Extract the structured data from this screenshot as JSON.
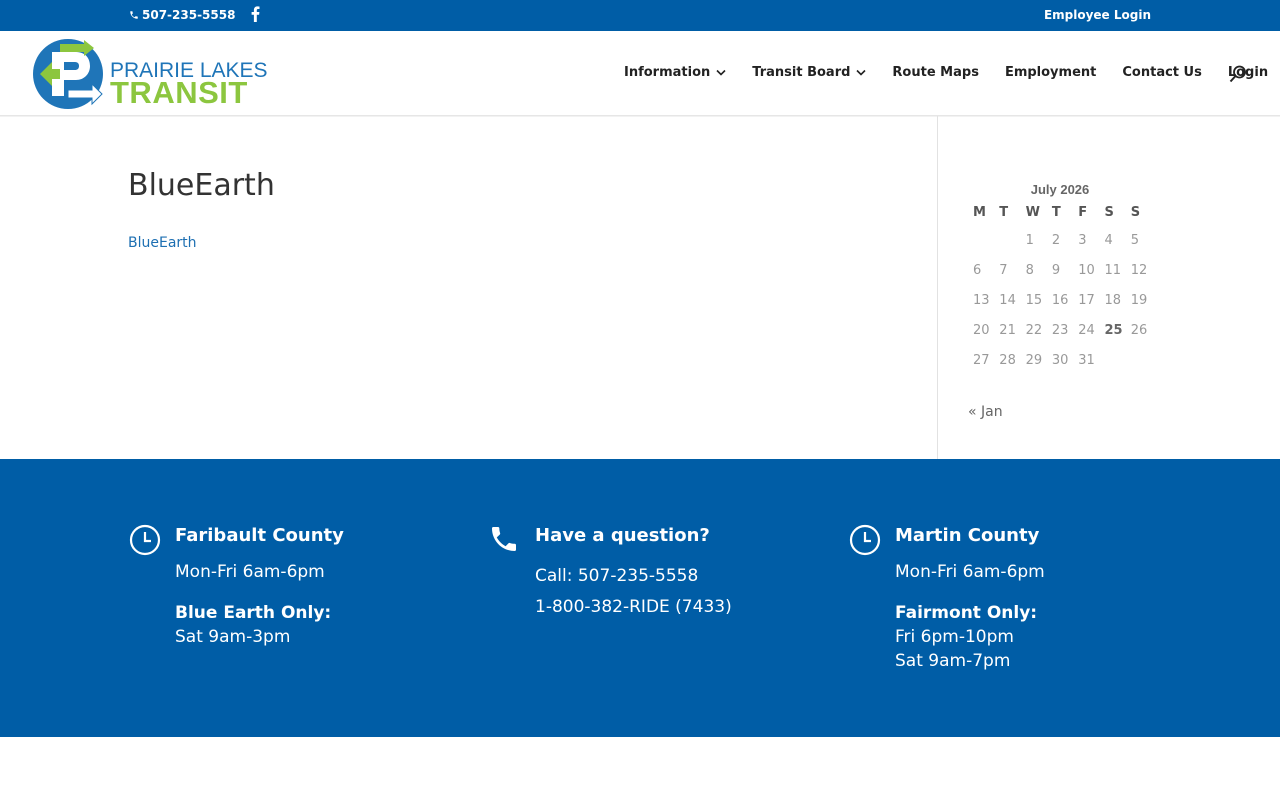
{
  "topbar": {
    "phone": "507-235-5558",
    "facebook_icon": "facebook-icon",
    "employee_login": "Employee Login"
  },
  "logo": {
    "line1": "PRAIRIE LAKES",
    "line2": "TRANSIT"
  },
  "nav": {
    "items": [
      {
        "label": "Information",
        "has_dropdown": true
      },
      {
        "label": "Transit Board",
        "has_dropdown": true
      },
      {
        "label": "Route Maps",
        "has_dropdown": false
      },
      {
        "label": "Employment",
        "has_dropdown": false
      },
      {
        "label": "Contact Us",
        "has_dropdown": false
      },
      {
        "label": "Login",
        "has_dropdown": false
      }
    ],
    "search_icon": "search-icon"
  },
  "main": {
    "title": "BlueEarth",
    "link": "BlueEarth"
  },
  "calendar": {
    "caption": "July 2026",
    "weekdays": [
      "M",
      "T",
      "W",
      "T",
      "F",
      "S",
      "S"
    ],
    "weeks": [
      [
        "",
        "",
        "1",
        "2",
        "3",
        "4",
        "5"
      ],
      [
        "6",
        "7",
        "8",
        "9",
        "10",
        "11",
        "12"
      ],
      [
        "13",
        "14",
        "15",
        "16",
        "17",
        "18",
        "19"
      ],
      [
        "20",
        "21",
        "22",
        "23",
        "24",
        "25",
        "26"
      ],
      [
        "27",
        "28",
        "29",
        "30",
        "31",
        "",
        ""
      ]
    ],
    "today": "25",
    "prev_link": "« Jan"
  },
  "footer": {
    "col1": {
      "icon": "clock-icon",
      "heading": "Faribault County",
      "hours": "Mon-Fri 6am-6pm",
      "sub_heading": "Blue Earth Only:",
      "sub_lines": [
        "Sat 9am-3pm"
      ]
    },
    "col2": {
      "icon": "phone-icon",
      "heading": "Have a question?",
      "lines": [
        "Call: 507-235-5558",
        "1-800-382-RIDE (7433)"
      ]
    },
    "col3": {
      "icon": "clock-icon",
      "heading": "Martin County",
      "hours": "Mon-Fri 6am-6pm",
      "sub_heading": "Fairmont Only:",
      "sub_lines": [
        "Fri 6pm-10pm",
        "Sat 9am-7pm"
      ]
    }
  },
  "colors": {
    "brand_blue": "#005da6",
    "logo_green": "#8cc63f",
    "link_blue": "#1d6fb2"
  }
}
